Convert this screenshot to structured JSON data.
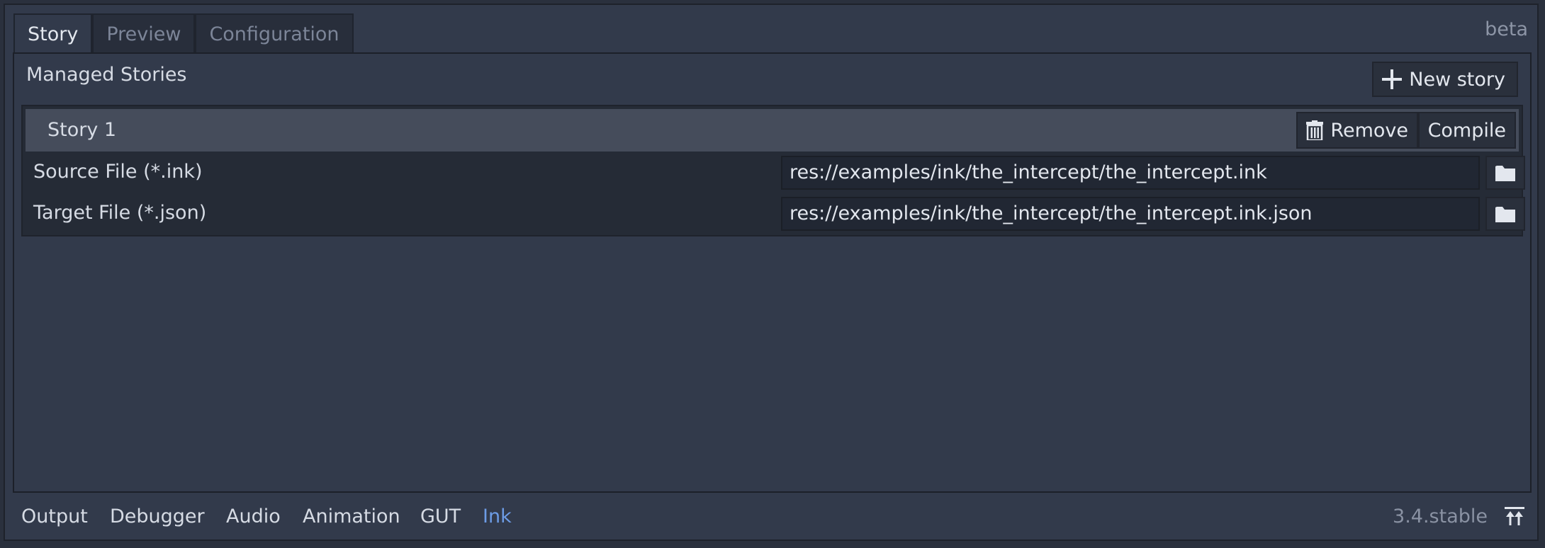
{
  "tabs": [
    {
      "label": "Story",
      "active": true
    },
    {
      "label": "Preview",
      "active": false
    },
    {
      "label": "Configuration",
      "active": false
    }
  ],
  "beta_label": "beta",
  "managed": {
    "title": "Managed Stories",
    "new_story_label": "New story"
  },
  "story": {
    "name": "Story 1",
    "remove_label": "Remove",
    "compile_label": "Compile",
    "source": {
      "label": "Source File (*.ink)",
      "value": "res://examples/ink/the_intercept/the_intercept.ink"
    },
    "target": {
      "label": "Target File (*.json)",
      "value": "res://examples/ink/the_intercept/the_intercept.ink.json"
    }
  },
  "bottom": {
    "tabs": [
      {
        "label": "Output",
        "active": false
      },
      {
        "label": "Debugger",
        "active": false
      },
      {
        "label": "Audio",
        "active": false
      },
      {
        "label": "Animation",
        "active": false
      },
      {
        "label": "GUT",
        "active": false
      },
      {
        "label": "Ink",
        "active": true
      }
    ],
    "version": "3.4.stable"
  },
  "colors": {
    "accent": "#6d9ce6",
    "panel_bg": "#323a4b",
    "header_bg": "#454c5b"
  },
  "icons": {
    "new_story": "plus-icon",
    "remove": "trash-icon",
    "browse": "folder-icon",
    "expand": "expand-up-icon"
  }
}
